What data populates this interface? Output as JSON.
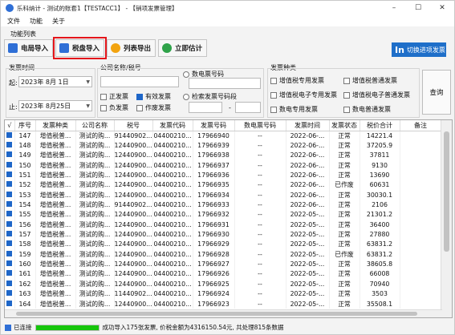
{
  "window": {
    "title": "乐科纳计 - 测试的账套1【TESTACC1】 - 【销项发票管理】",
    "min": "–",
    "max": "☐",
    "close": "✕"
  },
  "menu": [
    "文件",
    "功能",
    "关于"
  ],
  "function_list_label": "功能列表",
  "toolbar": [
    {
      "label": "电局导入",
      "icon": "doc-icon"
    },
    {
      "label": "税盘导入",
      "icon": "disk-icon",
      "highlight": true
    },
    {
      "label": "列表导出",
      "icon": "export-icon"
    },
    {
      "label": "立即估计",
      "icon": "clock-icon"
    }
  ],
  "switch_button": {
    "logo": "In",
    "label": "切换进项发票"
  },
  "filters": {
    "time_title": "发票时间",
    "start_label": "起:",
    "start_date": "2023年  8月  1日",
    "end_label": "止:",
    "end_date": "2023年  8月25日",
    "company_title": "公司名称/税号",
    "normal_invoice": "正发票",
    "negative_invoice": "负发票",
    "valid_invoice": "有效发票",
    "void_invoice": "作废发票",
    "digital_number_label": "数电票号码",
    "range_label": "检索发票号码段",
    "range_dash": "-",
    "type_title": "发票种类",
    "types": [
      "增值税专用发票",
      "增值税普通发票",
      "增值税电子专用发票",
      "增值税电子普通发票",
      "数电专用发票",
      "数电普通发票"
    ],
    "query": "查询"
  },
  "table": {
    "headers": [
      "√",
      "序号",
      "发票种类",
      "公司名称",
      "税号",
      "发票代码",
      "发票号码",
      "数电票号码",
      "发票时间",
      "发票状态",
      "税价合计",
      "备注"
    ],
    "rows": [
      [
        "147",
        "增值税普...",
        "测试的购...",
        "91440902...",
        "04400210...",
        "17966940",
        "--",
        "2022-06-...",
        "正常",
        "14221.4"
      ],
      [
        "148",
        "增值税普...",
        "测试的购...",
        "12440900...",
        "04400210...",
        "17966939",
        "--",
        "2022-06-...",
        "正常",
        "37205.9"
      ],
      [
        "149",
        "增值税普...",
        "测试的购...",
        "12440900...",
        "04400210...",
        "17966938",
        "--",
        "2022-06-...",
        "正常",
        "37811"
      ],
      [
        "150",
        "增值税普...",
        "测试的购...",
        "12440900...",
        "04400210...",
        "17966937",
        "--",
        "2022-06-...",
        "正常",
        "9130"
      ],
      [
        "151",
        "增值税普...",
        "测试的购...",
        "12440900...",
        "04400210...",
        "17966936",
        "--",
        "2022-06-...",
        "正常",
        "13690"
      ],
      [
        "152",
        "增值税普...",
        "测试的购...",
        "12440900...",
        "04400210...",
        "17966935",
        "--",
        "2022-06-...",
        "已作废",
        "60631"
      ],
      [
        "153",
        "增值税普...",
        "测试的购...",
        "12440900...",
        "04400210...",
        "17966934",
        "--",
        "2022-06-...",
        "正常",
        "30030.1"
      ],
      [
        "154",
        "增值税普...",
        "测试的购...",
        "91440902...",
        "04400210...",
        "17966933",
        "--",
        "2022-06-...",
        "正常",
        "2106"
      ],
      [
        "155",
        "增值税普...",
        "测试的购...",
        "12440900...",
        "04400210...",
        "17966932",
        "--",
        "2022-05-...",
        "正常",
        "21301.2"
      ],
      [
        "156",
        "增值税普...",
        "测试的购...",
        "12440900...",
        "04400210...",
        "17966931",
        "--",
        "2022-05-...",
        "正常",
        "36400"
      ],
      [
        "157",
        "增值税普...",
        "测试的购...",
        "12440900...",
        "04400210...",
        "17966930",
        "--",
        "2022-05-...",
        "正常",
        "27880"
      ],
      [
        "158",
        "增值税普...",
        "测试的购...",
        "12440900...",
        "04400210...",
        "17966929",
        "--",
        "2022-05-...",
        "正常",
        "63831.2"
      ],
      [
        "159",
        "增值税普...",
        "测试的购...",
        "12440900...",
        "04400210...",
        "17966928",
        "--",
        "2022-05-...",
        "已作废",
        "63831.2"
      ],
      [
        "160",
        "增值税普...",
        "测试的购...",
        "12440900...",
        "04400210...",
        "17966927",
        "--",
        "2022-05-...",
        "正常",
        "38605.8"
      ],
      [
        "161",
        "增值税普...",
        "测试的购...",
        "12440900...",
        "04400210...",
        "17966926",
        "--",
        "2022-05-...",
        "正常",
        "66008"
      ],
      [
        "162",
        "增值税普...",
        "测试的购...",
        "12440900...",
        "04400210...",
        "17966925",
        "--",
        "2022-05-...",
        "正常",
        "70940"
      ],
      [
        "163",
        "增值税普...",
        "测试的购...",
        "11440902...",
        "04400210...",
        "17966924",
        "--",
        "2022-05-...",
        "正常",
        "3503"
      ],
      [
        "164",
        "增值税普...",
        "测试的购...",
        "12440900...",
        "04400210...",
        "17966923",
        "--",
        "2022-05-...",
        "正常",
        "35508.1"
      ]
    ]
  },
  "status": {
    "connected": "已连接",
    "progress": 1.0,
    "message": "成功导入175张发票, 价税金额为4316150.54元, 共处理815条数据"
  },
  "colors": {
    "accent": "#1f6fc9",
    "highlight": "#e4161b",
    "progress": "#16c60c"
  }
}
